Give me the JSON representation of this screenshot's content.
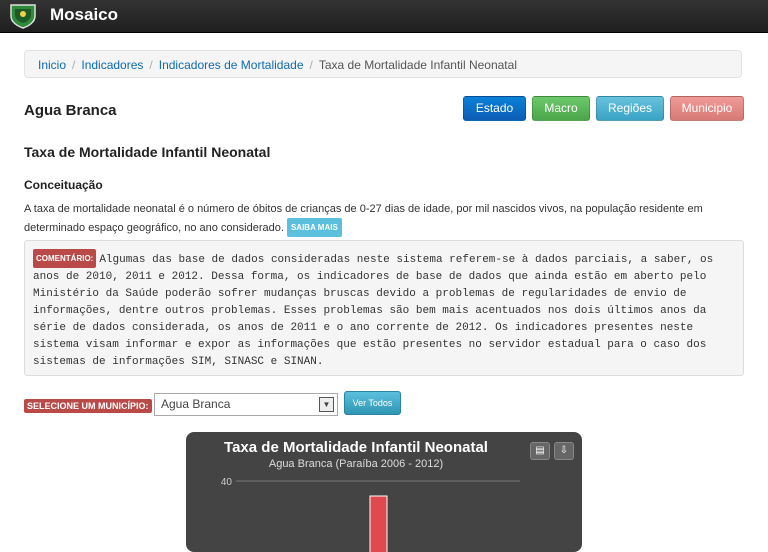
{
  "app": {
    "title": "Mosaico"
  },
  "breadcrumb": [
    "Inicio",
    "Indicadores",
    "Indicadores de Mortalidade",
    "Taxa de Mortalidade Infantil Neonatal"
  ],
  "municipality": "Agua Branca",
  "buttons": {
    "estado": "Estado",
    "macro": "Macro",
    "regioes": "Regiões",
    "municipio": "Municipio"
  },
  "indicator": {
    "title": "Taxa de Mortalidade Infantil Neonatal",
    "concept_heading": "Conceituação",
    "description": "A taxa de mortalidade neonatal é o número de óbitos de crianças de 0-27 dias de idade, por mil nascidos vivos, na população residente em determinado espaço geográfico, no ano considerado.",
    "saiba_mais": "SAIBA MAIS"
  },
  "comment": {
    "tag": "COMENTÁRIO:",
    "text": "Algumas das base de dados consideradas neste sistema referem-se à dados parciais, a saber, os anos de 2010, 2011 e 2012. Dessa forma, os indicadores de base de dados que ainda estão em aberto pelo Ministério da Saúde poderão sofrer mudanças bruscas devido a problemas de regularidades de envio de informações, dentre outros problemas. Esses problemas são bem mais acentuados nos dois últimos anos da série de dados considerada, os anos de 2011 e o ano corrente de 2012. Os indicadores presentes neste sistema visam informar e expor as informações que estão presentes no servidor estadual para o caso dos sistemas de informações SIM, SINASC e SINAN."
  },
  "selector": {
    "label": "SELECIONE UM MUNICÍPIO:",
    "value": "Agua Branca",
    "button": "Ver Todos"
  },
  "colors": {
    "bar": "#e04a4f",
    "chart_bg": "#444444",
    "estado": "#0c6fc7",
    "macro": "#5cb85c",
    "regioes": "#5bc0de",
    "municipio": "#e08a87"
  },
  "chart_data": {
    "type": "bar",
    "title": "Taxa de Mortalidade Infantil Neonatal",
    "subtitle": "Agua Branca (Paraíba 2006 - 2012)",
    "y_ticks": [
      40
    ],
    "ylim": [
      0,
      45
    ],
    "grid": true,
    "values": [
      35
    ]
  }
}
